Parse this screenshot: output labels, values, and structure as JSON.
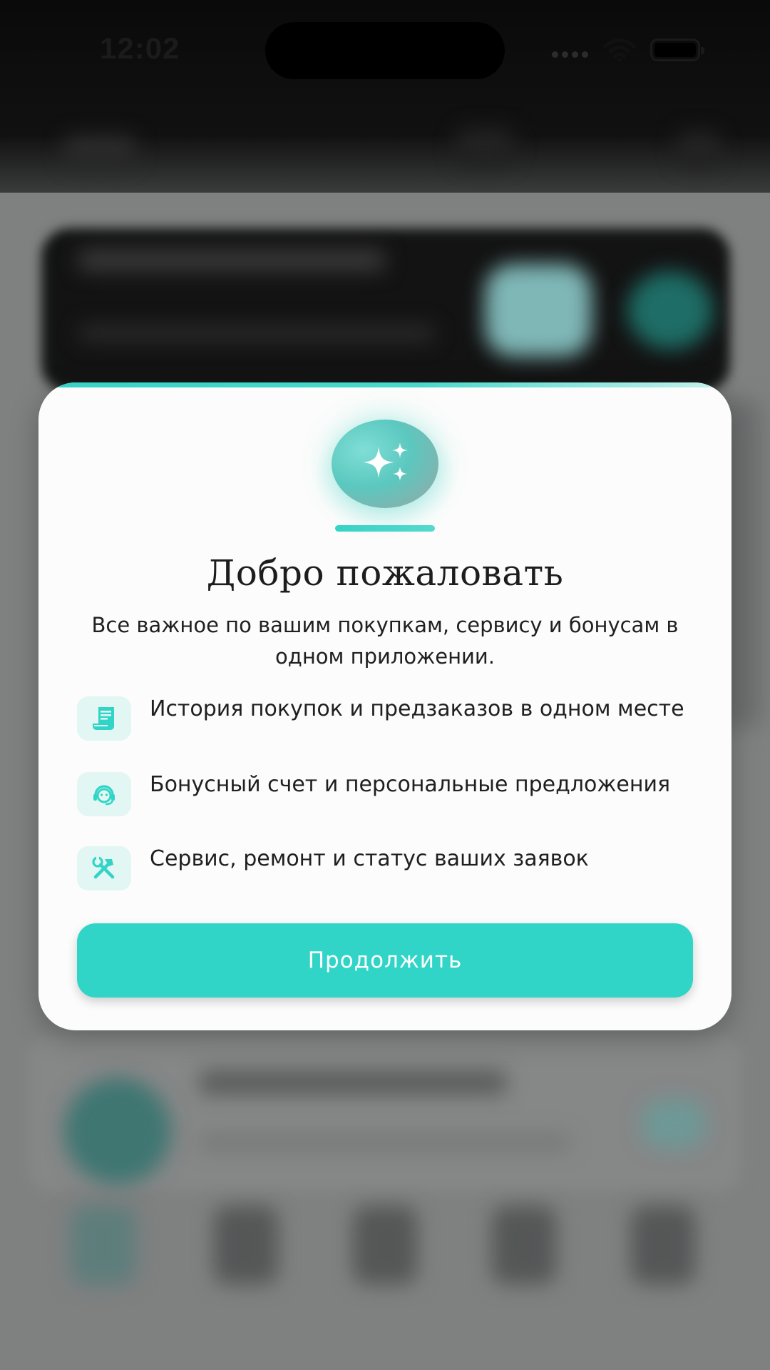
{
  "status_bar": {
    "time": "12:02",
    "signal_icon": "signal-dots-icon",
    "wifi_icon": "wifi-icon",
    "battery_icon": "battery-full-icon"
  },
  "modal": {
    "hero_icon": "sparkles-icon",
    "title": "Добро пожаловать",
    "subtitle": "Все важное по вашим покупкам, сервису и бонусам в одном приложении.",
    "features": [
      {
        "icon": "receipt-icon",
        "text": "История покупок и предзаказов в одном месте"
      },
      {
        "icon": "support-agent-icon",
        "text": "Бонусный счет и персональные предложения"
      },
      {
        "icon": "tools-icon",
        "text": "Сервис, ремонт и статус ваших заявок"
      }
    ],
    "continue_label": "Продолжить"
  },
  "colors": {
    "accent": "#31d5c7",
    "accent_light": "#e2f6f3",
    "modal_bg": "#fbfcfb",
    "text": "#1f1f1f",
    "overlay": "#7d7e7e"
  }
}
